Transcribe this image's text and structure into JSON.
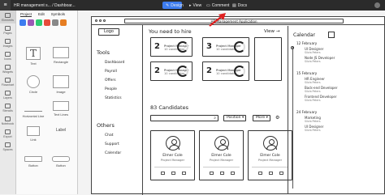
{
  "topbar": {
    "filename": "HR management s... / Dashboar...",
    "design": "Design",
    "view": "View",
    "comment": "Comment",
    "docs": "Docs"
  },
  "rail": [
    "Elements",
    "Pages",
    "Images",
    "Icons",
    "Widgets",
    "Flowchart",
    "Layers",
    "Stencils",
    "Notebook",
    "Export",
    "Spaces"
  ],
  "panel": {
    "tab_project": "Project",
    "tab_edit": "Edit",
    "tab_symbols": "Symbols",
    "components": [
      "Text",
      "Rectangle",
      "Circle",
      "Image",
      "Horizontal Line",
      "Text Lines",
      "Link",
      "Label",
      "Button",
      "Button"
    ]
  },
  "frame": {
    "url": "HR Management Application",
    "logo": "Logo",
    "tools_heading": "Tools",
    "tools": [
      "Dashboard",
      "Payroll",
      "Offers",
      "People",
      "Statistics"
    ],
    "others_heading": "Others",
    "others": [
      "Chat",
      "Support",
      "Calendar"
    ],
    "hire_heading": "You need to hire",
    "view_label": "View",
    "hire_cards": [
      {
        "num": "2",
        "title": "Project Manager",
        "sub": "10 candidates"
      },
      {
        "num": "3",
        "title": "Project Manager",
        "sub": "10 candidates"
      },
      {
        "num": "2",
        "title": "Project Manager",
        "sub": "10 candidates"
      },
      {
        "num": "2",
        "title": "Project Manager",
        "sub": "10 candidates"
      }
    ],
    "candidates_heading": "83 Candidates",
    "position_label": "Position",
    "more_label": "More",
    "candidates": [
      {
        "name": "Elmer Cole",
        "role": "Project Manager"
      },
      {
        "name": "Elmer Cole",
        "role": "Project Manager"
      },
      {
        "name": "Elmer Cole",
        "role": "Project Manager"
      }
    ],
    "calendar": {
      "heading": "Calendar",
      "groups": [
        {
          "date": "12 February",
          "events": [
            {
              "t": "UI Designer",
              "s": "Silvia Peters"
            },
            {
              "t": "Node JS Developer",
              "s": "Silvia Peters"
            }
          ]
        },
        {
          "date": "15 February",
          "events": [
            {
              "t": "HR Engineer",
              "s": "Silvia Peters"
            },
            {
              "t": "Back-end Developer",
              "s": "Silvia Peters"
            },
            {
              "t": "Frontend Developer",
              "s": "Silvia Peters"
            }
          ]
        },
        {
          "date": "24 February",
          "events": [
            {
              "t": "Marketing",
              "s": "Silvia Peters"
            },
            {
              "t": "UI Designer",
              "s": "Silvia Peters"
            }
          ]
        }
      ]
    }
  }
}
